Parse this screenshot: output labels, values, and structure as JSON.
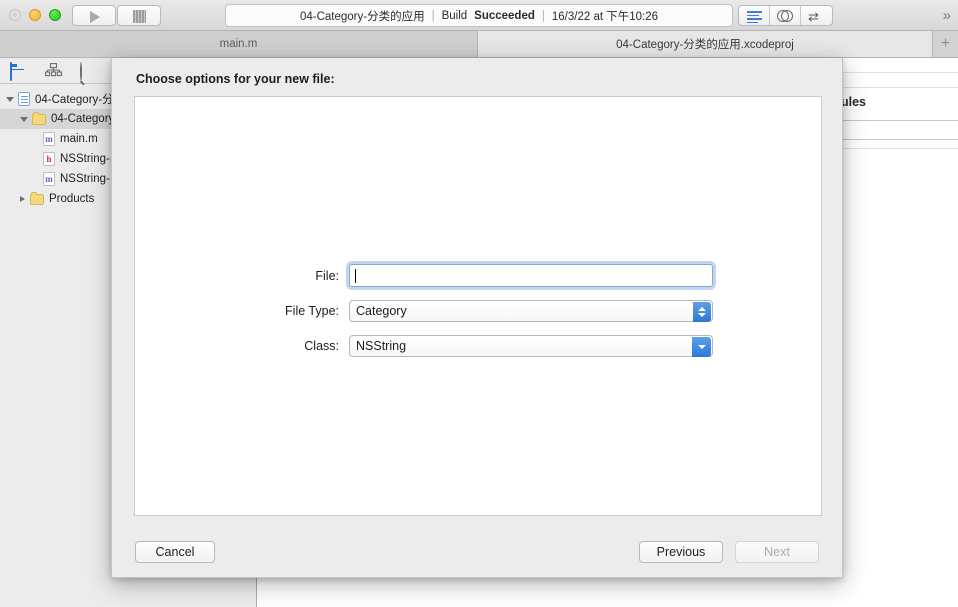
{
  "window": {
    "traffic_lights": [
      "close",
      "minimize",
      "zoom"
    ],
    "run_button_label": "Run",
    "stop_button_label": "Stop",
    "status": {
      "scheme": "04-Category-分类的应用",
      "separator": "|",
      "build_prefix": "Build",
      "build_result": "Succeeded",
      "timestamp": "16/3/22 at 下午10:26"
    },
    "editor_modes": [
      {
        "name": "standard-editor",
        "label": "Standard Editor"
      },
      {
        "name": "assistant-editor",
        "label": "Assistant Editor"
      },
      {
        "name": "version-editor",
        "label": "Version Editor"
      }
    ],
    "overflow_label": "»"
  },
  "tabs": [
    {
      "label": "main.m",
      "active": false
    },
    {
      "label": "04-Category-分类的应用.xcodeproj",
      "active": true
    }
  ],
  "tab_add_label": "+",
  "navigator": {
    "toolbar_icons": [
      "folder-icon",
      "hierarchy-icon",
      "search-icon",
      "warning-icon"
    ],
    "tree": [
      {
        "label": "04-Category-分",
        "icon": "project-icon",
        "indent": 0,
        "disclosure": "open",
        "selected": false
      },
      {
        "label": "04-Category",
        "icon": "folder-icon",
        "indent": 1,
        "disclosure": "open",
        "selected": true
      },
      {
        "label": "main.m",
        "icon": "m-file-icon",
        "indent": 2,
        "disclosure": "none",
        "selected": false
      },
      {
        "label": "NSString-",
        "icon": "h-file-icon",
        "indent": 2,
        "disclosure": "none",
        "selected": false
      },
      {
        "label": "NSString-",
        "icon": "m-file-icon",
        "indent": 2,
        "disclosure": "none",
        "selected": false
      },
      {
        "label": "Products",
        "icon": "folder-icon",
        "indent": 1,
        "disclosure": "closed",
        "selected": false
      }
    ]
  },
  "editor_background": {
    "partial_heading": "ules"
  },
  "sheet": {
    "title": "Choose options for your new file:",
    "fields": [
      {
        "name": "file",
        "label": "File:",
        "type": "text",
        "value": "",
        "focused": true
      },
      {
        "name": "file-type",
        "label": "File Type:",
        "type": "popup",
        "value": "Category",
        "focused": false
      },
      {
        "name": "class",
        "label": "Class:",
        "type": "combo",
        "value": "NSString",
        "focused": false
      }
    ],
    "buttons": [
      {
        "name": "cancel",
        "label": "Cancel",
        "enabled": true
      },
      {
        "name": "previous",
        "label": "Previous",
        "enabled": true
      },
      {
        "name": "next",
        "label": "Next",
        "enabled": false
      }
    ]
  },
  "colors": {
    "accent_blue": "#2a78d6",
    "focus_ring": "#6ea5e1",
    "toolbar_bg": "#e2e2e2",
    "sheet_bg": "#ececec",
    "navigator_bg": "#ececec",
    "folder_yellow": "#f3d97c",
    "build_success_text": "#2b2b2b",
    "minimize_yellow": "#f5b12c",
    "zoom_green": "#24c41e"
  }
}
